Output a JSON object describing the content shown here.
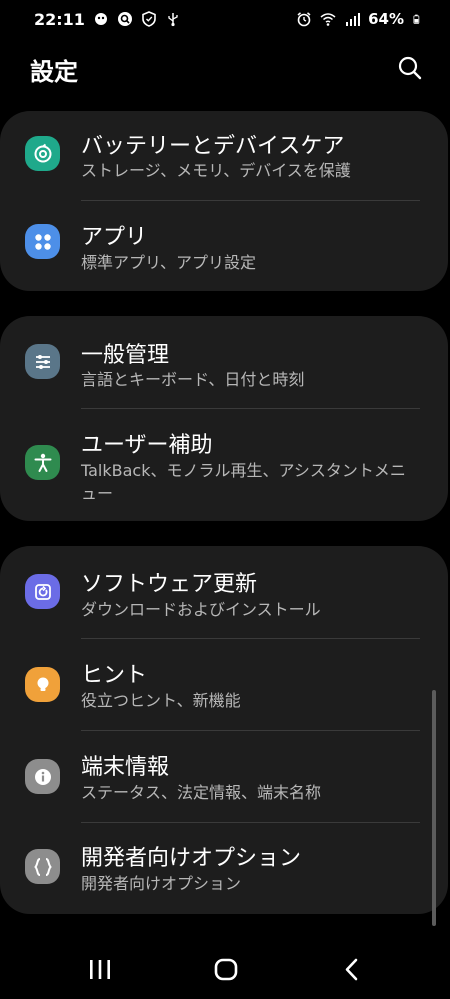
{
  "status": {
    "time": "22:11",
    "battery": "64%",
    "left_icons": [
      "notification-icon",
      "search-app-icon",
      "shield-icon",
      "usb-icon"
    ],
    "right_icons": [
      "alarm-icon",
      "wifi-icon",
      "signal-icon",
      "battery-icon"
    ]
  },
  "header": {
    "title": "設定"
  },
  "groups": [
    {
      "items": [
        {
          "label": "バッテリーとデバイスケア",
          "sub": "ストレージ、メモリ、デバイスを保護",
          "icon": "device-care-icon",
          "color": "#1fa98b"
        },
        {
          "label": "アプリ",
          "sub": "標準アプリ、アプリ設定",
          "icon": "apps-icon",
          "color": "#4d8fe8"
        }
      ]
    },
    {
      "items": [
        {
          "label": "一般管理",
          "sub": "言語とキーボード、日付と時刻",
          "icon": "general-management-icon",
          "color": "#5a7689"
        },
        {
          "label": "ユーザー補助",
          "sub": "TalkBack、モノラル再生、アシスタントメニュー",
          "icon": "accessibility-icon",
          "color": "#2f8b4f"
        }
      ]
    },
    {
      "items": [
        {
          "label": "ソフトウェア更新",
          "sub": "ダウンロードおよびインストール",
          "icon": "software-update-icon",
          "color": "#6b6ce6"
        },
        {
          "label": "ヒント",
          "sub": "役立つヒント、新機能",
          "icon": "tips-icon",
          "color": "#f0a13a"
        },
        {
          "label": "端末情報",
          "sub": "ステータス、法定情報、端末名称",
          "icon": "info-icon",
          "color": "#8d8d8d"
        },
        {
          "label": "開発者向けオプション",
          "sub": "開発者向けオプション",
          "icon": "developer-options-icon",
          "color": "#8d8d8d"
        }
      ]
    }
  ],
  "navbar": {
    "buttons": [
      "recent-apps",
      "home",
      "back"
    ]
  }
}
